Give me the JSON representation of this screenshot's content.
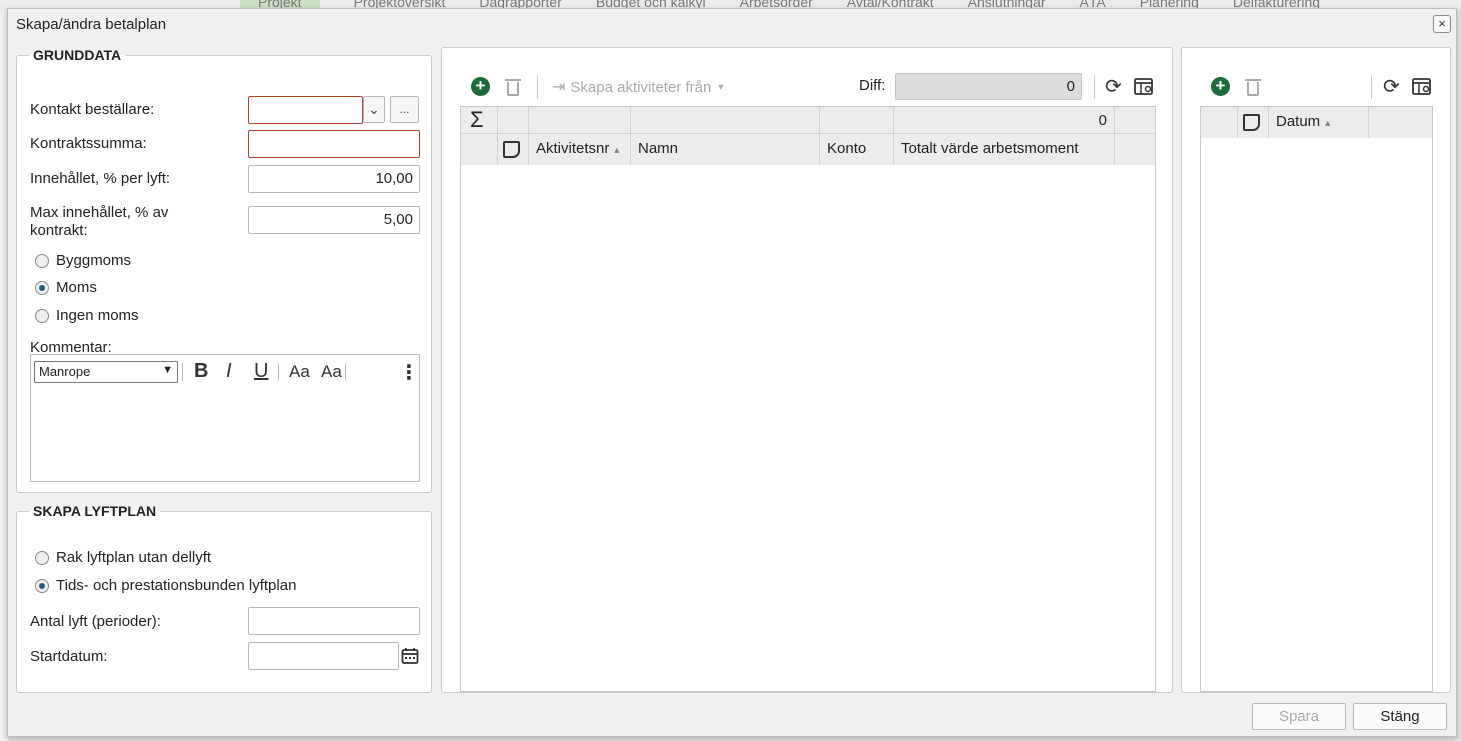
{
  "background": {
    "tabs": [
      "Projekt",
      "Projektöversikt",
      "Dagrapporter",
      "Budget och kalkyl",
      "Arbetsorder",
      "Avtal/Kontrakt",
      "Anslutningar",
      "ÄTA",
      "Planering",
      "Delfakturering"
    ]
  },
  "dialog": {
    "title": "Skapa/ändra betalplan",
    "close_label": "×"
  },
  "grunddata": {
    "legend": "GRUNDDATA",
    "kontakt_label": "Kontakt beställare:",
    "kontakt_value": "",
    "browse_label": "...",
    "kontraktssumma_label": "Kontraktssumma:",
    "kontraktssumma_value": "",
    "innehallet_label": "Innehållet, % per lyft:",
    "innehallet_value": "10,00",
    "max_label": "Max innehållet, % av kontrakt:",
    "max_value": "5,00",
    "moms_options": [
      {
        "label": "Byggmoms",
        "checked": false
      },
      {
        "label": "Moms",
        "checked": true
      },
      {
        "label": "Ingen moms",
        "checked": false
      }
    ],
    "kommentar_label": "Kommentar:",
    "editor_font": "Manrope",
    "editor_tools": [
      "B",
      "I",
      "U",
      "Aa",
      "Aa",
      "⋮"
    ]
  },
  "lyftplan": {
    "legend": "SKAPA LYFTPLAN",
    "options": [
      {
        "label": "Rak lyftplan utan dellyft",
        "checked": false
      },
      {
        "label": "Tids- och prestationsbunden lyftplan",
        "checked": true
      }
    ],
    "antal_label": "Antal lyft (perioder):",
    "antal_value": "",
    "startdatum_label": "Startdatum:",
    "startdatum_value": ""
  },
  "activities": {
    "create_from_label": "Skapa aktiviteter från",
    "diff_label": "Diff:",
    "diff_value": "0",
    "summary_value": "0",
    "columns": [
      "Aktivitetsnr",
      "Namn",
      "Konto",
      "Totalt värde arbetsmoment"
    ]
  },
  "dates": {
    "columns": [
      "Datum"
    ]
  },
  "footer": {
    "save_label": "Spara",
    "close_label": "Stäng"
  }
}
